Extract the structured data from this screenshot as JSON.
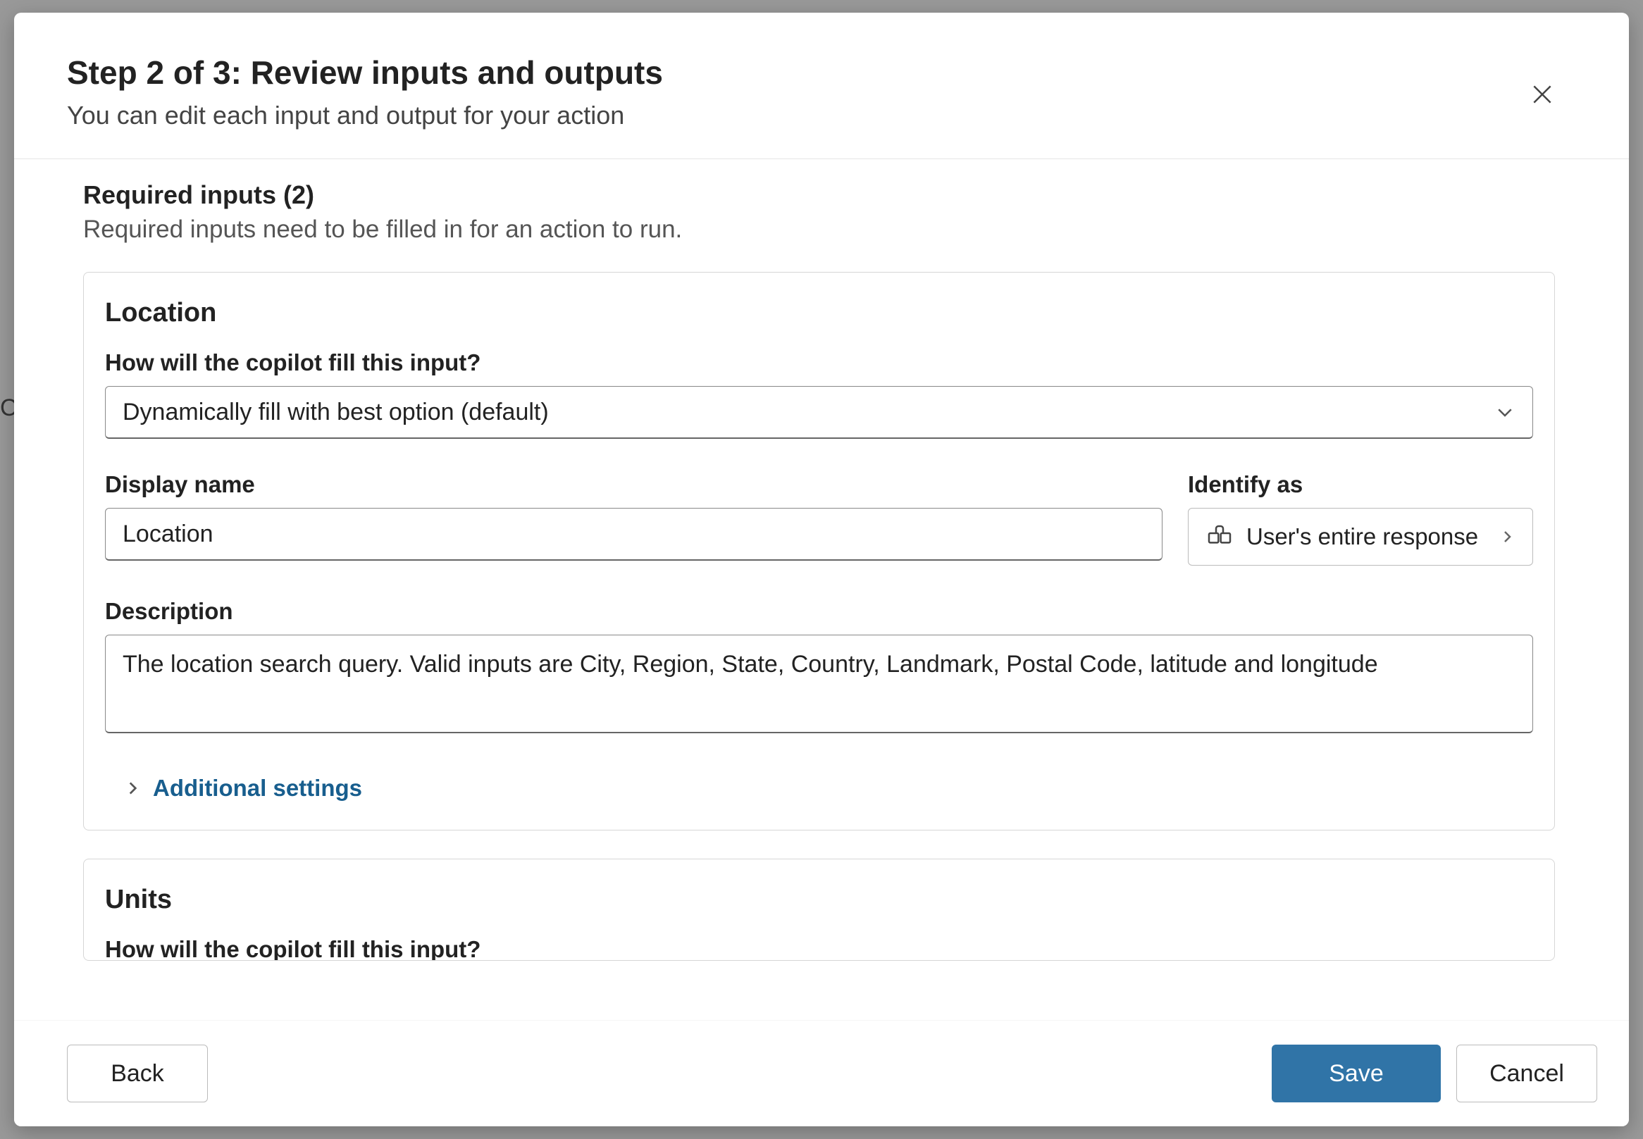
{
  "backdrop_text": "Co",
  "header": {
    "title": "Step 2 of 3: Review inputs and outputs",
    "subtitle": "You can edit each input and output for your action"
  },
  "section": {
    "title": "Required inputs (2)",
    "subtitle": "Required inputs need to be filled in for an action to run."
  },
  "inputs": [
    {
      "name": "Location",
      "fill_label": "How will the copilot fill this input?",
      "fill_value": "Dynamically fill with best option (default)",
      "display_name_label": "Display name",
      "display_name_value": "Location",
      "identify_label": "Identify as",
      "identify_value": "User's entire response",
      "description_label": "Description",
      "description_value": "The location search query. Valid inputs are City, Region, State, Country, Landmark, Postal Code, latitude and longitude",
      "additional_label": "Additional settings"
    },
    {
      "name": "Units",
      "fill_label": "How will the copilot fill this input?"
    }
  ],
  "footer": {
    "back": "Back",
    "save": "Save",
    "cancel": "Cancel"
  }
}
